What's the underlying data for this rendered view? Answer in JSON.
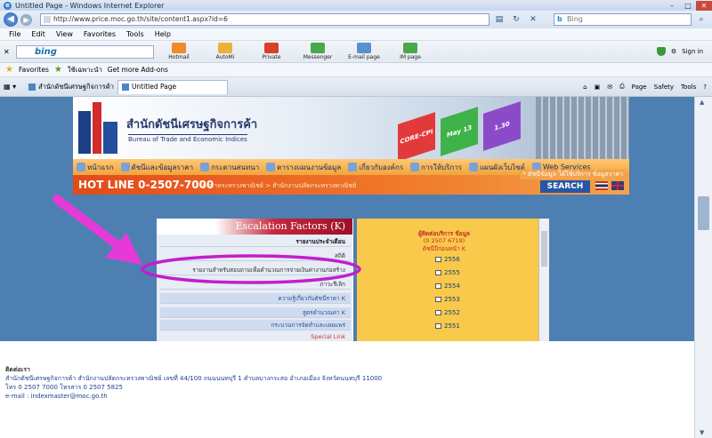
{
  "browser": {
    "window_title": "Untitled Page - Windows Internet Explorer",
    "url": "http://www.price.moc.go.th/site/content1.aspx?id=6",
    "search_placeholder": "Bing",
    "menu": [
      "File",
      "Edit",
      "View",
      "Favorites",
      "Tools",
      "Help"
    ],
    "bing_logo": "bing",
    "links": [
      {
        "label": "Hotmail",
        "color": "#f08a2a"
      },
      {
        "label": "AutoMi",
        "color": "#e9b23a"
      },
      {
        "label": "Private",
        "color": "#d9402a"
      },
      {
        "label": "Messenger",
        "color": "#4aa84a"
      },
      {
        "label": "E-mail page",
        "color": "#5a8fd0"
      },
      {
        "label": "IM page",
        "color": "#4aa84a"
      }
    ],
    "sign_in": "Sign in",
    "favorites_label": "Favorites",
    "fav_items": [
      "ใช้เฉพาะนำ",
      "Get more Add-ons"
    ],
    "tabs": [
      "สำนักดัชนีเศรษฐกิจการค้า",
      "Untitled Page"
    ],
    "commands": [
      "Page",
      "Safety",
      "Tools"
    ]
  },
  "site": {
    "agency_th": "สำนักดัชนีเศรษฐกิจการค้า",
    "agency_en": "Bureau of Trade and Economic Indices",
    "cubes": [
      "CORE-CPI",
      "May 13",
      "1.30"
    ],
    "nav": [
      "หน้าแรก",
      "ดัชนีและข้อมูลราคา",
      "กระดานสนทนา",
      "ตารางแผนงานข้อมูล",
      "เกี่ยวกับองค์กร",
      "การให้บริการ",
      "แผนผังเว็บไซต์",
      "Web Services"
    ],
    "hotline": "HOT LINE 0-2507-7000",
    "breadcrumb": "ภาษาทระทรวงพาณิชย์ > สำนักงานปลัดกระทรวงพาณิชย์",
    "notice": "* ดัชนีข้อมูล ได้ใช้บริการ ข้อมูลราคา",
    "search_button": "SEARCH"
  },
  "content": {
    "title": "Escalation Factors (K)",
    "menu": [
      {
        "label": "รายงานประจำเดือน",
        "style": "head"
      },
      {
        "label": "สถิติ",
        "style": "plain"
      },
      {
        "label": "รายงานสำหรับสอบถามเพื่อคำนวณการจ่ายเงินค่างานก่อสร้าง",
        "style": "plain"
      },
      {
        "label": "ภาวะรีเลิก",
        "style": "plain"
      },
      {
        "label": "ความรู้เกี่ยวกับดัชนีราคา K",
        "style": "blue"
      },
      {
        "label": "สูตรคำนวณค่า K",
        "style": "blue"
      },
      {
        "label": "กระบวนการจัดทำและเผยแพร่",
        "style": "blue"
      },
      {
        "label": "Special Link",
        "style": "link"
      }
    ],
    "contact_line1": "ผู้ติดต่อบริการ ข้อมูล",
    "contact_phone": "(0 2507 6719)",
    "contact_line3": "ดัชนีปีก่อนหน้า K",
    "years": [
      "2556",
      "2555",
      "2554",
      "2553",
      "2552",
      "2551"
    ]
  },
  "footer": {
    "title": "ติดต่อเรา",
    "address": "สำนักดัชนีเศรษฐกิจการค้า สำนักงานปลัดกระทรวงพาณิชย์ เลขที่ 44/100 ถนนนนทบุรี 1 ตำบลบางกระสอ อำเภอเมือง จังหวัดนนทบุรี 11000",
    "phone": "โทร 0 2507 7000 โทรสาร 0 2507 5825",
    "email": "e-mail : indexmaster@moc.go.th"
  }
}
